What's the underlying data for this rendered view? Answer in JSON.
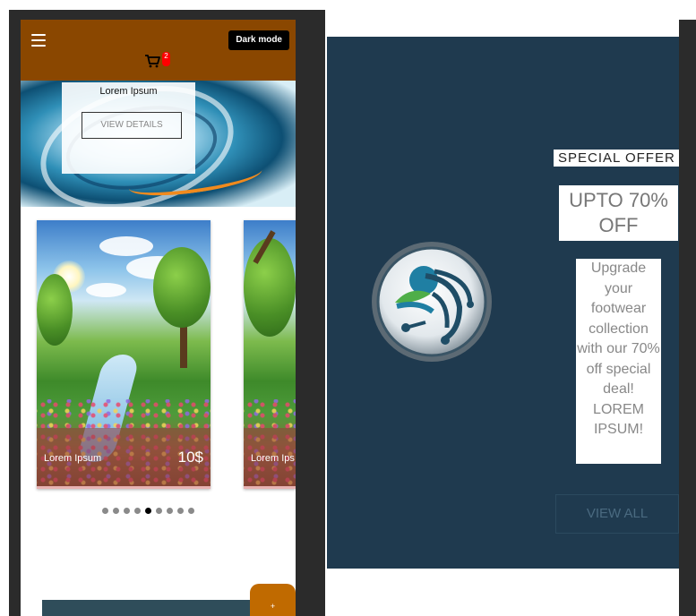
{
  "header": {
    "dark_mode_label": "Dark mode",
    "cart_count": "2",
    "background_color": "#8a4700"
  },
  "hero": {
    "title": "Lorem Ipsum",
    "button_label": "VIEW DETAILS"
  },
  "carousel": {
    "cards": [
      {
        "name": "Lorem Ipsum",
        "price": "10$"
      },
      {
        "name": "Lorem Ips"
      }
    ],
    "dot_count": 9,
    "active_dot_index": 4
  },
  "fab": {
    "label": "+"
  },
  "promo": {
    "background_color": "#1f3a4f",
    "special_label": "SPECIAL OFFER",
    "discount_text": "UPTO 70% OFF",
    "description": "Upgrade your footwear collection with our 70% off special deal! LOREM IPSUM!",
    "button_label": "VIEW ALL",
    "logo_icon": "circuit-leaf-logo"
  }
}
